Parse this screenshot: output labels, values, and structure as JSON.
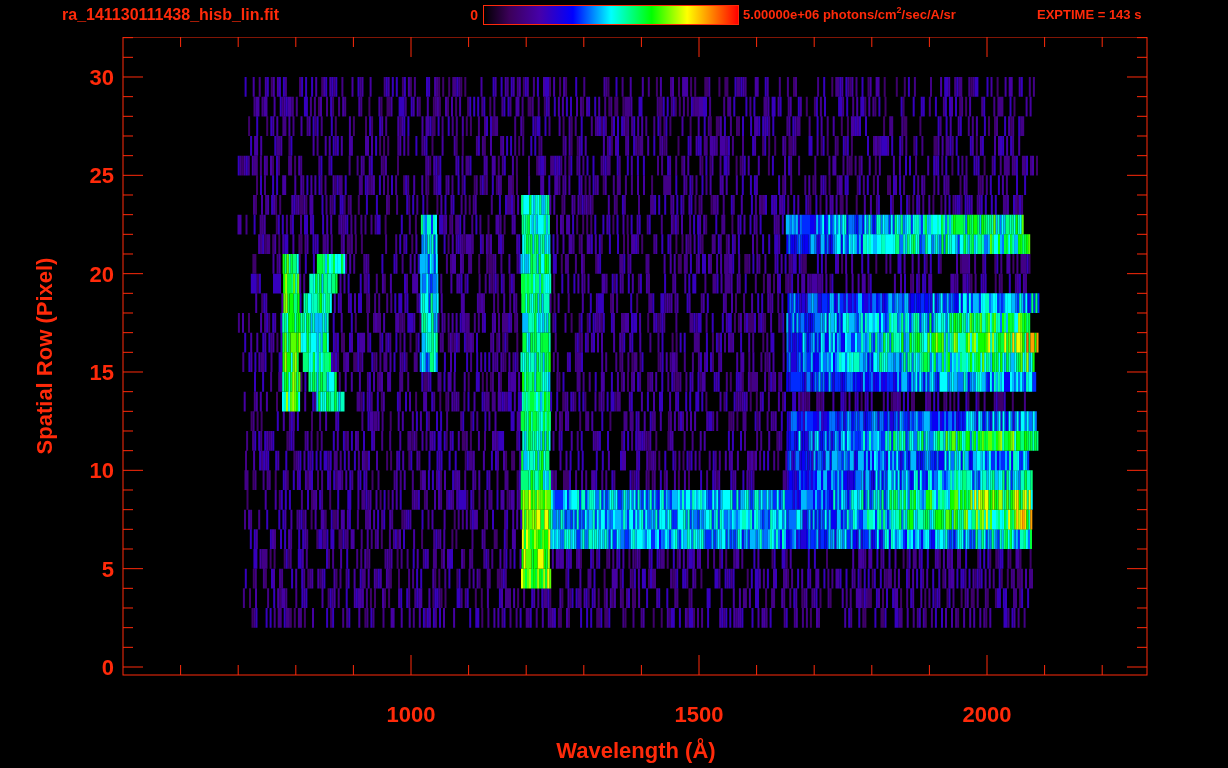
{
  "title": "ra_141130111438_hisb_lin.fit",
  "colorbar": {
    "min_label": "0",
    "max_label": "5.00000e+06 photons/cm$^{2}$/sec/A/sr"
  },
  "exposure": "EXPTIME = 143 s",
  "x_axis": {
    "title": "Wavelength (Å)",
    "tick_labels": [
      "1000",
      "1500",
      "2000"
    ]
  },
  "y_axis": {
    "title": "Spatial Row (Pixel)",
    "tick_labels": [
      "30",
      "25",
      "20",
      "15",
      "10",
      "5",
      "0"
    ]
  }
}
